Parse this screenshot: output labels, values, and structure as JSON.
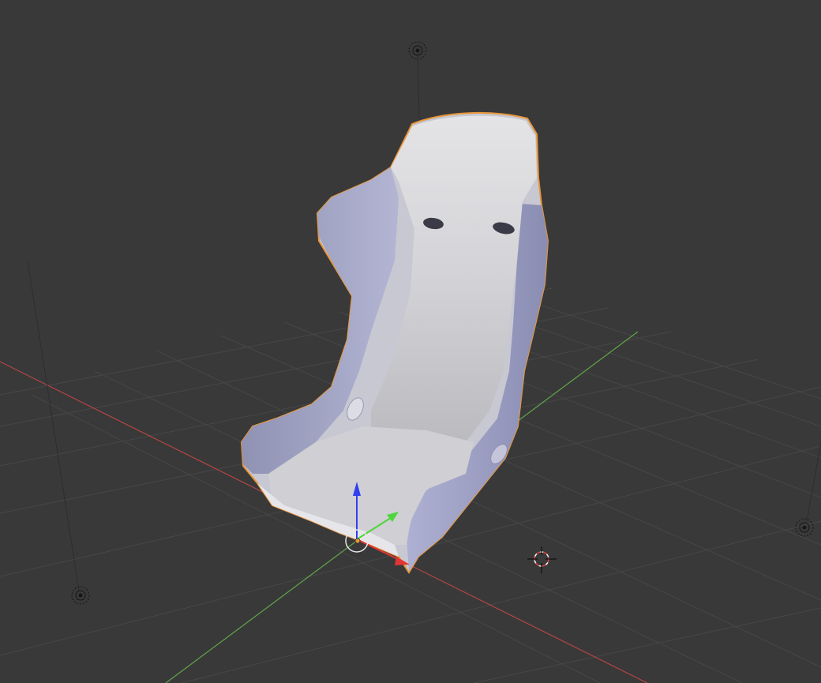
{
  "viewport": {
    "name": "3D Viewport",
    "background": "#393939",
    "grid_color": "#474747",
    "x_axis_color": "#b44545",
    "y_axis_color": "#5fa64b"
  },
  "scene": {
    "object": "racing-seat",
    "object_fill": "#c7c8d2",
    "object_side_fill": "#a4a6c6",
    "selection_outline": "#e8963a"
  },
  "gizmo": {
    "x_color": "#e23535",
    "y_color": "#4fd63a",
    "z_color": "#2f3ff0",
    "origin_color": "#e8963a"
  },
  "lamps": [
    {
      "name": "lamp-top"
    },
    {
      "name": "lamp-left"
    },
    {
      "name": "lamp-right"
    }
  ]
}
